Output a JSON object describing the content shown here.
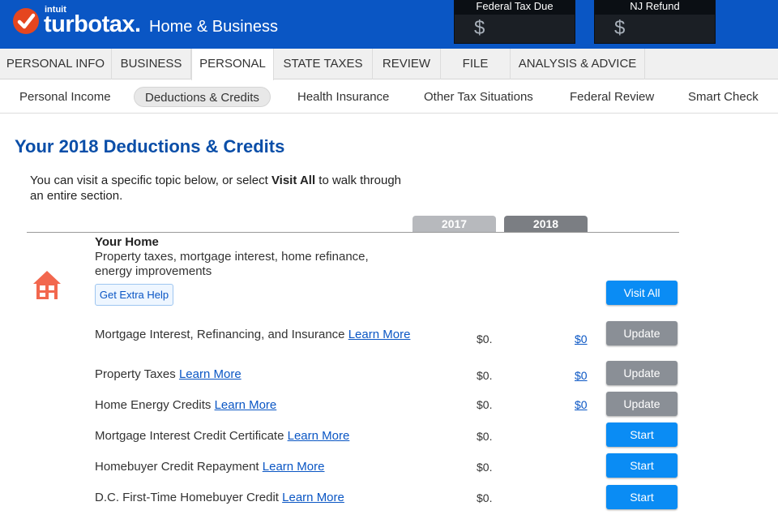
{
  "header": {
    "brand_small": "intuit",
    "brand_main": "turbotax.",
    "brand_sub": "Home & Business",
    "federal": {
      "label": "Federal Tax Due",
      "amount": "$"
    },
    "state": {
      "label": "NJ Refund",
      "amount": "$"
    }
  },
  "tabs": [
    {
      "label": "PERSONAL INFO"
    },
    {
      "label": "BUSINESS"
    },
    {
      "label": "PERSONAL"
    },
    {
      "label": "STATE TAXES"
    },
    {
      "label": "REVIEW"
    },
    {
      "label": "FILE"
    },
    {
      "label": "ANALYSIS & ADVICE"
    }
  ],
  "subtabs": [
    {
      "label": "Personal Income"
    },
    {
      "label": "Deductions & Credits"
    },
    {
      "label": "Health Insurance"
    },
    {
      "label": "Other Tax Situations"
    },
    {
      "label": "Federal Review"
    },
    {
      "label": "Smart Check"
    }
  ],
  "page": {
    "title": "Your 2018 Deductions & Credits",
    "intro_pre": "You can visit a specific topic below, or select ",
    "intro_bold": "Visit All",
    "intro_post": " to walk through an entire section."
  },
  "years": {
    "y1": "2017",
    "y2": "2018"
  },
  "section": {
    "title": "Your Home",
    "description": "Property taxes, mortgage interest, home refinance, energy improvements",
    "help_label": "Get Extra Help",
    "visit_all_label": "Visit All"
  },
  "rows": [
    {
      "label": "Mortgage Interest, Refinancing, and Insurance",
      "link": "Learn More",
      "y2017": "$0.",
      "y2018": "$0",
      "action": "Update"
    },
    {
      "label": "Property Taxes",
      "link": "Learn More",
      "y2017": "$0.",
      "y2018": "$0",
      "action": "Update"
    },
    {
      "label": "Home Energy Credits",
      "link": "Learn More",
      "y2017": "$0.",
      "y2018": "$0",
      "action": "Update"
    },
    {
      "label": "Mortgage Interest Credit Certificate",
      "link": "Learn More",
      "y2017": "$0.",
      "y2018": "",
      "action": "Start"
    },
    {
      "label": "Homebuyer Credit Repayment",
      "link": "Learn More",
      "y2017": "$0.",
      "y2018": "",
      "action": "Start"
    },
    {
      "label": "D.C. First-Time Homebuyer Credit",
      "link": "Learn More",
      "y2017": "$0.",
      "y2018": "",
      "action": "Start"
    }
  ],
  "colors": {
    "brand_blue": "#0a56c4",
    "logo_orange": "#e5461f",
    "start_blue": "#0a8cf4",
    "update_gray": "#8a8f96",
    "year_2017": "#b7b9bd",
    "year_2018": "#7b7e83",
    "home_icon": "#f2674e"
  },
  "icons": {
    "logo": "checkmark-icon",
    "section": "house-icon"
  }
}
